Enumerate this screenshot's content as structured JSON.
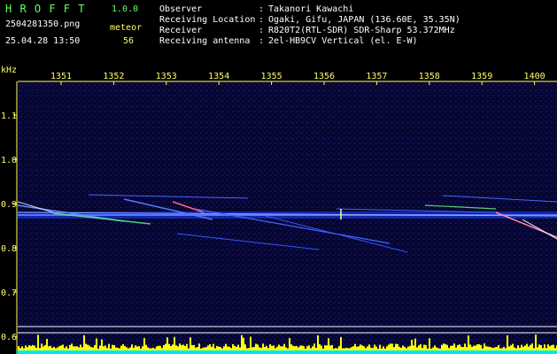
{
  "header": {
    "title": "H R O F F T",
    "version": "1.0.0",
    "filename": "2504281350.png",
    "datetime": "25.04.28 13:50",
    "meteor_label": "meteor",
    "meteor_count": "56",
    "info": [
      {
        "label": "Observer",
        "value": "Takanori Kawachi"
      },
      {
        "label": "Receiving Location",
        "value": "Ogaki, Gifu, JAPAN (136.60E, 35.35N)"
      },
      {
        "label": "Receiver",
        "value": "R820T2(RTL-SDR) SDR-Sharp 53.372MHz"
      },
      {
        "label": "Receiving antenna",
        "value": "2el-HB9CV Vertical (el. E-W)"
      }
    ]
  },
  "spectrogram": {
    "unit_label": "kHz",
    "time_ticks": [
      "1351",
      "1352",
      "1353",
      "1354",
      "1355",
      "1356",
      "1357",
      "1358",
      "1359",
      "1400"
    ],
    "freq_ticks": [
      "1.1",
      "1.0",
      "0.9",
      "0.8",
      "0.7",
      "0.6"
    ],
    "freq_values": [
      1.1,
      1.0,
      0.9,
      0.8,
      0.7,
      0.6
    ],
    "colors": {
      "background": "#06063a",
      "signal": "#3a5cff",
      "trace": "#ffffff",
      "level": "#ffff00",
      "axis": "#ffff66"
    }
  }
}
